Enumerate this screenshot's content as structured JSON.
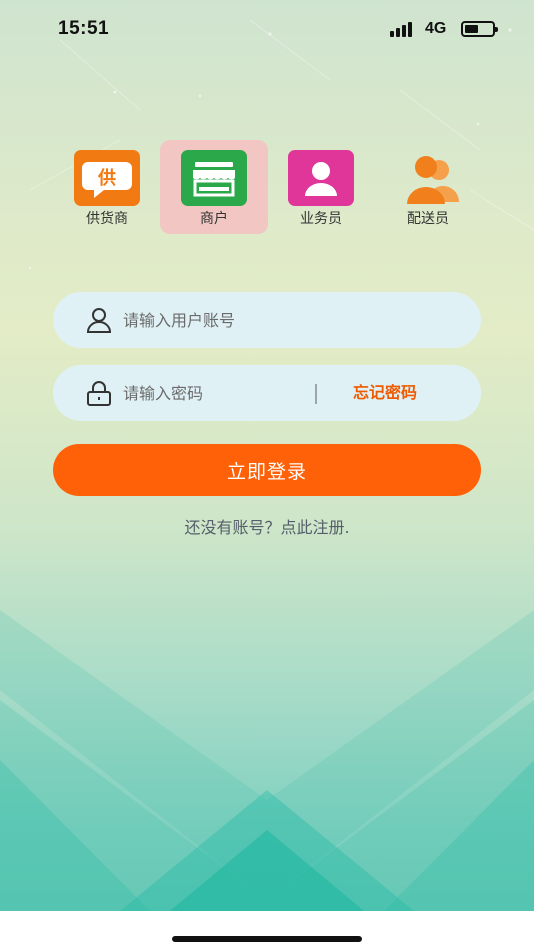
{
  "status_bar": {
    "time": "15:51",
    "network": "4G",
    "battery_level": 0.5
  },
  "roles": [
    {
      "label": "供货商",
      "icon": "supplier-icon",
      "icon_text": "供",
      "color": "#f27a13",
      "selected": false
    },
    {
      "label": "商户",
      "icon": "store-icon",
      "color": "#2aa84a",
      "selected": true
    },
    {
      "label": "业务员",
      "icon": "salesperson-icon",
      "color": "#e0369a",
      "selected": false
    },
    {
      "label": "配送员",
      "icon": "delivery-people-icon",
      "color": "#f07f1c",
      "selected": false
    }
  ],
  "form": {
    "username_placeholder": "请输入用户账号",
    "password_placeholder": "请输入密码",
    "forgot_label": "忘记密码",
    "login_label": "立即登录",
    "register_prompt": "还没有账号？点此注册."
  },
  "colors": {
    "accent": "#fe6107",
    "selected_role_bg": "#f1c6c3",
    "field_bg": "#e0f1f6"
  }
}
